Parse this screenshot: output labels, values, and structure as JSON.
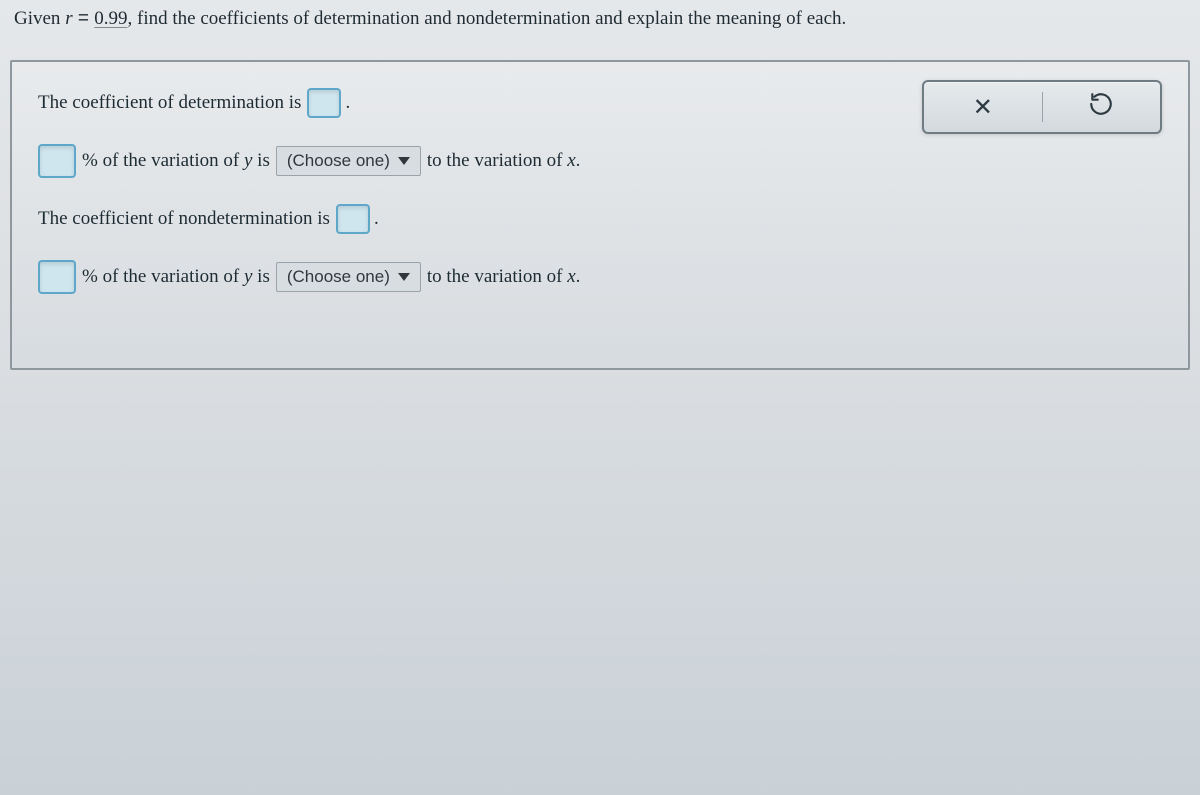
{
  "question": {
    "prefix": "Given ",
    "var": "r",
    "equals": " = ",
    "value": "0.99",
    "suffix": ", find the coefficients of determination and nondetermination and explain the meaning of each."
  },
  "panel": {
    "line1_a": "The coefficient of determination is",
    "line1_b": ".",
    "line2_a": "% of the variation of ",
    "line2_y": "y",
    "line2_b": " is",
    "line2_c": "to the variation of ",
    "line2_x": "x",
    "line2_d": ".",
    "line3_a": "The coefficient of nondetermination is",
    "line3_b": ".",
    "line4_a": "% of the variation of ",
    "line4_y": "y",
    "line4_b": " is",
    "line4_c": "to the variation of ",
    "line4_x": "x",
    "line4_d": "."
  },
  "dropdown_label": "(Choose one)",
  "toolbar": {
    "clear": "×",
    "reset": "↺"
  }
}
